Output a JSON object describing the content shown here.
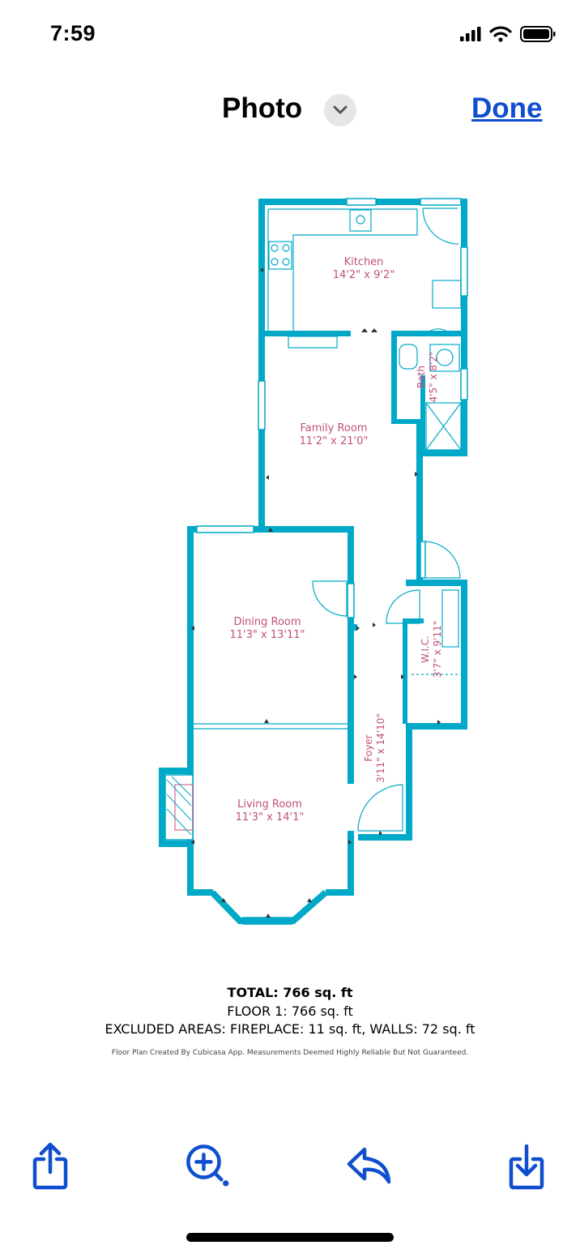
{
  "status_bar": {
    "time": "7:59"
  },
  "nav": {
    "title": "Photo",
    "done_label": "Done"
  },
  "rooms": {
    "kitchen": {
      "name": "Kitchen",
      "dims": "14'2\" x 9'2\""
    },
    "bath": {
      "name": "Bath",
      "dims": "4'5\" x 8'2\""
    },
    "family": {
      "name": "Family Room",
      "dims": "11'2\" x 21'0\""
    },
    "dining": {
      "name": "Dining Room",
      "dims": "11'3\" x 13'11\""
    },
    "wic": {
      "name": "W.I.C.",
      "dims": "3'7\" x 9'11\""
    },
    "foyer": {
      "name": "Foyer",
      "dims": "3'11\" x 14'10\""
    },
    "living": {
      "name": "Living Room",
      "dims": "11'3\" x 14'1\""
    }
  },
  "summary": {
    "total": "TOTAL: 766 sq. ft",
    "floor": "FLOOR 1: 766 sq. ft",
    "excluded": "EXCLUDED AREAS: FIREPLACE: 11 sq. ft, WALLS: 72 sq. ft",
    "credit": "Floor Plan Created By Cubicasa App. Measurements Deemed Highly Reliable But Not Guaranteed."
  },
  "colors": {
    "wall": "#00a9c7",
    "label": "#c0507a",
    "accent": "#0f4fcf"
  },
  "icons": [
    "signal-icon",
    "wifi-icon",
    "battery-icon",
    "chevron-down-icon",
    "share-icon",
    "markup-icon",
    "reply-icon",
    "save-icon"
  ]
}
